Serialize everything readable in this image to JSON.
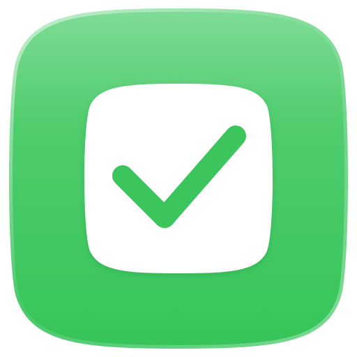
{
  "icon": {
    "semantic_name": "checkmark-icon",
    "badge_semantic_name": "app-badge-icon",
    "colors": {
      "background": "#ffffff",
      "badge_top": "#7fdc97",
      "badge_mid": "#4fcc6c",
      "badge_bottom": "#36c45a",
      "inner_square": "#ffffff",
      "checkmark": "#3bc55c"
    }
  }
}
